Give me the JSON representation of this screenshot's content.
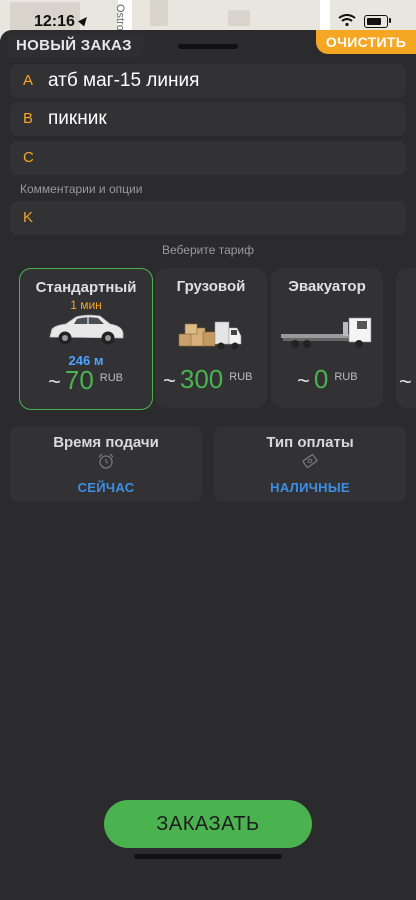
{
  "status": {
    "time": "12:16"
  },
  "map": {
    "street_fragment": "Ostro"
  },
  "header": {
    "title": "НОВЫЙ ЗАКАЗ",
    "clear_label": "ОЧИСТИТЬ"
  },
  "route": [
    {
      "letter": "A",
      "value": "атб маг-15 линия"
    },
    {
      "letter": "B",
      "value": "пикник"
    },
    {
      "letter": "C",
      "value": ""
    }
  ],
  "comment": {
    "label": "Комментарии и опции",
    "letter": "K",
    "value": ""
  },
  "tariff_prompt": "Веберите тариф",
  "tariffs": [
    {
      "name": "Стандартный",
      "eta": "1 мин",
      "distance": "246 м",
      "price": "70",
      "currency": "RUB",
      "icon": "car-icon",
      "selected": true
    },
    {
      "name": "Грузовой",
      "eta": "",
      "distance": "",
      "price": "300",
      "currency": "RUB",
      "icon": "cargo-truck-icon",
      "selected": false
    },
    {
      "name": "Эвакуатор",
      "eta": "",
      "distance": "",
      "price": "0",
      "currency": "RUB",
      "icon": "tow-truck-icon",
      "selected": false
    }
  ],
  "tilde": "~",
  "options": {
    "time": {
      "title": "Время подачи",
      "value": "СЕЙЧАС",
      "icon": "alarm-clock-icon"
    },
    "payment": {
      "title": "Тип оплаты",
      "value": "НАЛИЧНЫЕ",
      "icon": "cash-icon"
    }
  },
  "order_button": "ЗАКАЗАТЬ",
  "colors": {
    "accent": "#f5a623",
    "green": "#4ab34f",
    "blue": "#3d8ee6",
    "background": "#2b2b2d",
    "field": "#323234"
  }
}
